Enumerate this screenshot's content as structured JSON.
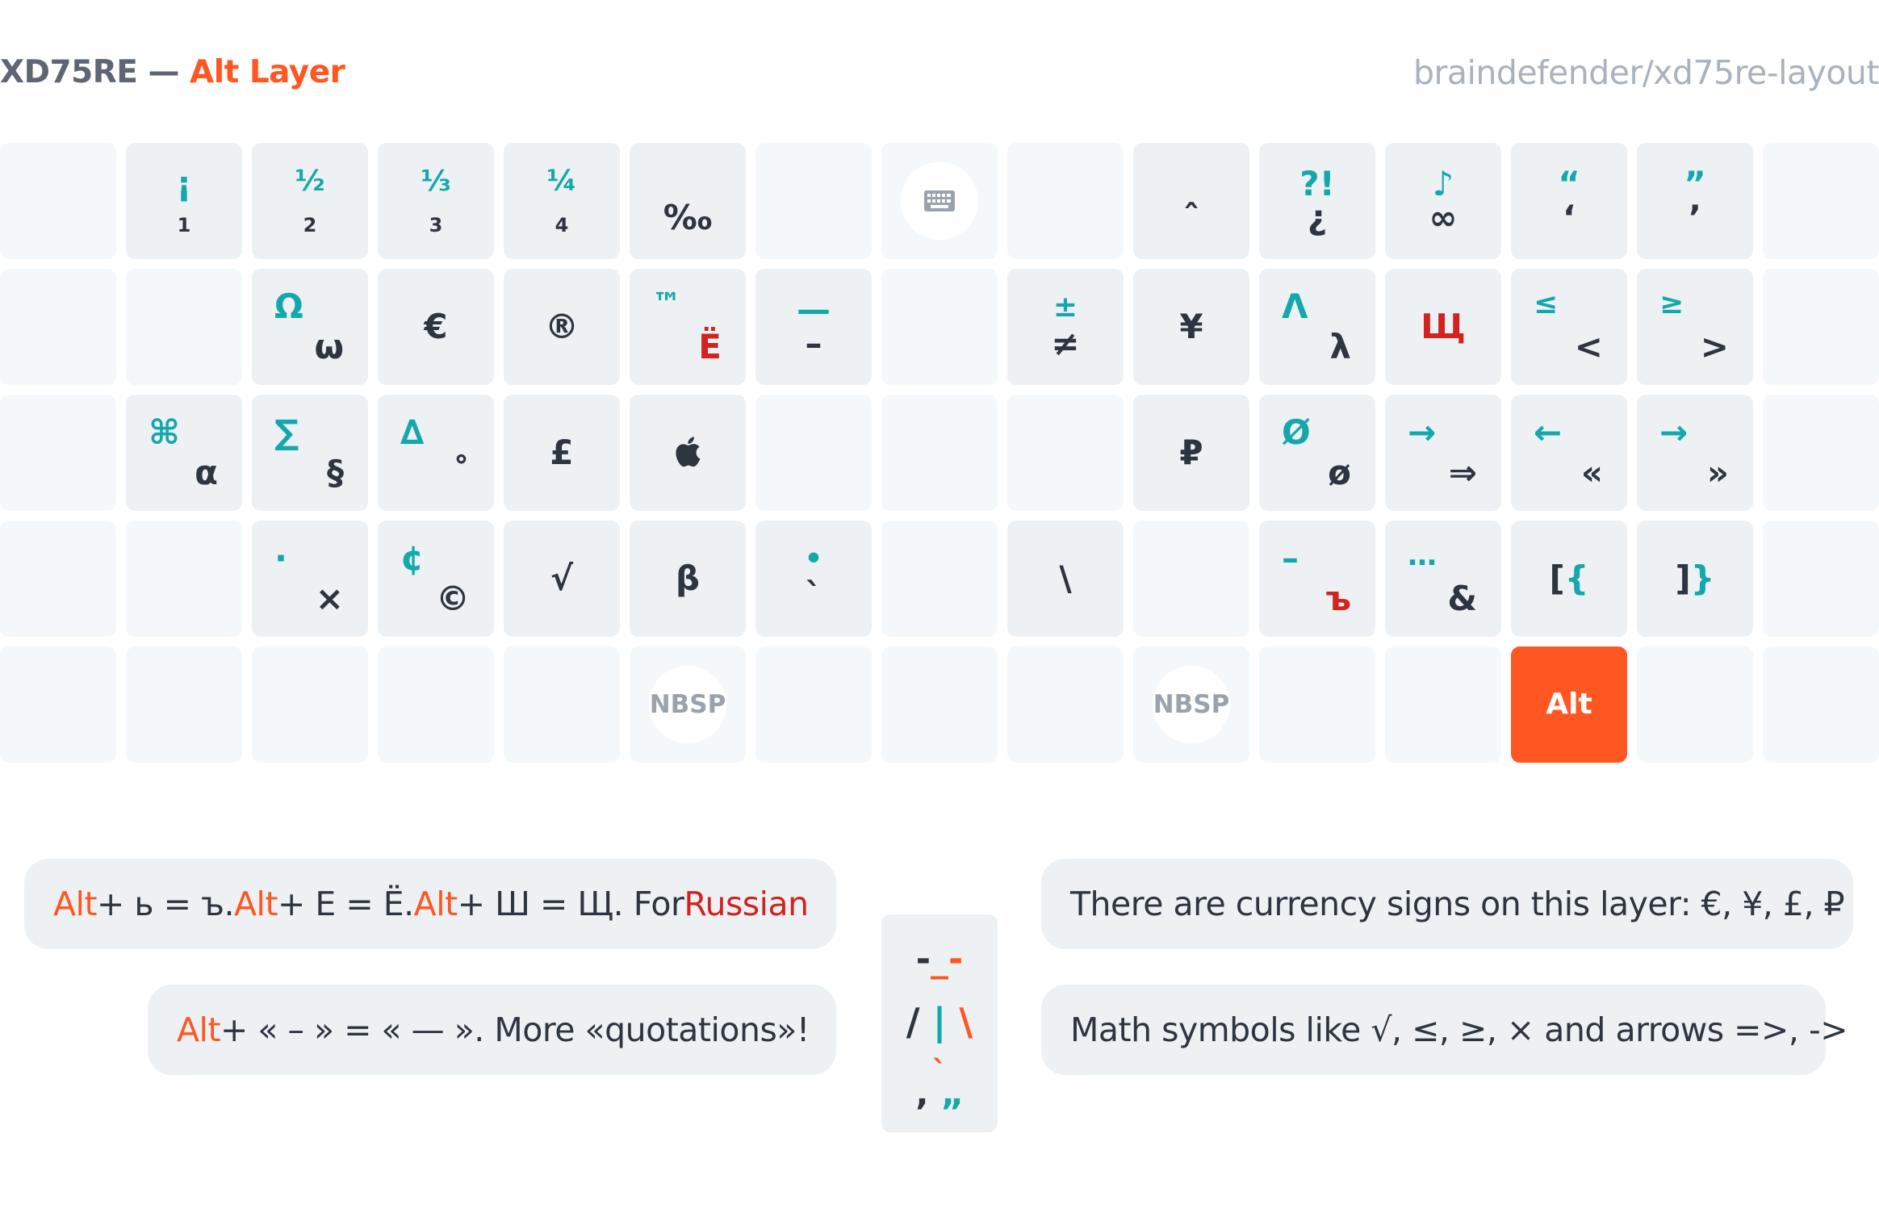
{
  "header": {
    "title_main": "XD75RE — ",
    "title_accent": "Alt Layer",
    "repo": "braindefender/xd75re-layout"
  },
  "colors": {
    "accent": "#ff5722",
    "teal": "#14a8ad",
    "red": "#d2231f",
    "dark": "#2d3540",
    "key_bg": "#edf1f4",
    "key_bg_empty": "#f5f8fa"
  },
  "keyboard": {
    "rows": [
      [
        {
          "bg": "light",
          "legends": []
        },
        {
          "bg": "mid",
          "legends": [
            {
              "text": "¡",
              "color": "t",
              "size": "l",
              "pos": "tc"
            },
            {
              "text": "1",
              "color": "d",
              "size": "s",
              "pos": "bc"
            }
          ]
        },
        {
          "bg": "mid",
          "legends": [
            {
              "text": "½",
              "color": "t",
              "size": "m",
              "pos": "tc"
            },
            {
              "text": "2",
              "color": "d",
              "size": "s",
              "pos": "bc"
            }
          ]
        },
        {
          "bg": "mid",
          "legends": [
            {
              "text": "⅓",
              "color": "t",
              "size": "m",
              "pos": "tc"
            },
            {
              "text": "3",
              "color": "d",
              "size": "s",
              "pos": "bc"
            }
          ]
        },
        {
          "bg": "mid",
          "legends": [
            {
              "text": "¼",
              "color": "t",
              "size": "m",
              "pos": "tc"
            },
            {
              "text": "4",
              "color": "d",
              "size": "s",
              "pos": "bc"
            }
          ]
        },
        {
          "bg": "mid",
          "legends": [
            {
              "text": "‰",
              "color": "d",
              "size": "l",
              "pos": "bc"
            }
          ]
        },
        {
          "bg": "light",
          "legends": []
        },
        {
          "bg": "light",
          "icon": "keyboard-icon",
          "legends": []
        },
        {
          "bg": "light",
          "legends": []
        },
        {
          "bg": "mid",
          "legends": [
            {
              "text": "ˆ",
              "color": "d",
              "size": "l",
              "pos": "bc"
            }
          ]
        },
        {
          "bg": "mid",
          "legends": [
            {
              "text": "?!",
              "color": "t",
              "size": "l",
              "pos": "tc"
            },
            {
              "text": "¿",
              "color": "d",
              "size": "l",
              "pos": "bc"
            }
          ]
        },
        {
          "bg": "mid",
          "legends": [
            {
              "text": "♪",
              "color": "t",
              "size": "l",
              "pos": "tc"
            },
            {
              "text": "∞",
              "color": "d",
              "size": "l",
              "pos": "bc"
            }
          ]
        },
        {
          "bg": "mid",
          "legends": [
            {
              "text": "“",
              "color": "t",
              "size": "l",
              "pos": "tc"
            },
            {
              "text": "‘",
              "color": "d",
              "size": "l",
              "pos": "bc"
            }
          ]
        },
        {
          "bg": "mid",
          "legends": [
            {
              "text": "”",
              "color": "t",
              "size": "l",
              "pos": "tc"
            },
            {
              "text": "’",
              "color": "d",
              "size": "l",
              "pos": "bc"
            }
          ]
        },
        {
          "bg": "light",
          "legends": []
        }
      ],
      [
        {
          "bg": "light",
          "legends": []
        },
        {
          "bg": "light",
          "legends": []
        },
        {
          "bg": "mid",
          "legends": [
            {
              "text": "Ω",
              "color": "t",
              "size": "l",
              "pos": "tl"
            },
            {
              "text": "ω",
              "color": "d",
              "size": "l",
              "pos": "br"
            }
          ]
        },
        {
          "bg": "mid",
          "legends": [
            {
              "text": "€",
              "color": "d",
              "size": "l",
              "pos": "c"
            }
          ]
        },
        {
          "bg": "mid",
          "legends": [
            {
              "text": "®",
              "color": "d",
              "size": "l",
              "pos": "c"
            }
          ]
        },
        {
          "bg": "mid",
          "legends": [
            {
              "text": "™",
              "color": "t",
              "size": "m",
              "pos": "tl"
            },
            {
              "text": "Ё",
              "color": "r",
              "size": "l",
              "pos": "br"
            }
          ]
        },
        {
          "bg": "mid",
          "legends": [
            {
              "text": "—",
              "color": "t",
              "size": "l",
              "pos": "tc"
            },
            {
              "text": "–",
              "color": "d",
              "size": "l",
              "pos": "bc"
            }
          ]
        },
        {
          "bg": "light",
          "legends": []
        },
        {
          "bg": "mid",
          "legends": [
            {
              "text": "±",
              "color": "t",
              "size": "m",
              "pos": "tc"
            },
            {
              "text": "≠",
              "color": "d",
              "size": "l",
              "pos": "bc"
            }
          ]
        },
        {
          "bg": "mid",
          "legends": [
            {
              "text": "¥",
              "color": "d",
              "size": "l",
              "pos": "c"
            }
          ]
        },
        {
          "bg": "mid",
          "legends": [
            {
              "text": "Λ",
              "color": "t",
              "size": "l",
              "pos": "tl"
            },
            {
              "text": "λ",
              "color": "d",
              "size": "l",
              "pos": "br"
            }
          ]
        },
        {
          "bg": "mid",
          "legends": [
            {
              "text": "Щ",
              "color": "r",
              "size": "l",
              "pos": "c"
            }
          ]
        },
        {
          "bg": "mid",
          "legends": [
            {
              "text": "≤",
              "color": "t",
              "size": "m",
              "pos": "tl"
            },
            {
              "text": "<",
              "color": "d",
              "size": "l",
              "pos": "br"
            }
          ]
        },
        {
          "bg": "mid",
          "legends": [
            {
              "text": "≥",
              "color": "t",
              "size": "m",
              "pos": "tl"
            },
            {
              "text": ">",
              "color": "d",
              "size": "l",
              "pos": "br"
            }
          ]
        },
        {
          "bg": "light",
          "legends": []
        }
      ],
      [
        {
          "bg": "light",
          "legends": []
        },
        {
          "bg": "mid",
          "legends": [
            {
              "text": "⌘",
              "color": "t",
              "size": "l",
              "pos": "tl"
            },
            {
              "text": "α",
              "color": "d",
              "size": "l",
              "pos": "br"
            }
          ]
        },
        {
          "bg": "mid",
          "legends": [
            {
              "text": "∑",
              "color": "t",
              "size": "l",
              "pos": "tl"
            },
            {
              "text": "§",
              "color": "d",
              "size": "l",
              "pos": "br"
            }
          ]
        },
        {
          "bg": "mid",
          "legends": [
            {
              "text": "∆",
              "color": "t",
              "size": "l",
              "pos": "tl"
            },
            {
              "text": "˚",
              "color": "d",
              "size": "l",
              "pos": "br"
            }
          ]
        },
        {
          "bg": "mid",
          "legends": [
            {
              "text": "£",
              "color": "d",
              "size": "l",
              "pos": "c"
            }
          ]
        },
        {
          "bg": "mid",
          "icon": "apple-logo-icon",
          "legends": []
        },
        {
          "bg": "light",
          "legends": []
        },
        {
          "bg": "light",
          "legends": []
        },
        {
          "bg": "light",
          "legends": []
        },
        {
          "bg": "mid",
          "legends": [
            {
              "text": "₽",
              "color": "d",
              "size": "l",
              "pos": "c"
            }
          ]
        },
        {
          "bg": "mid",
          "legends": [
            {
              "text": "Ø",
              "color": "t",
              "size": "l",
              "pos": "tl"
            },
            {
              "text": "ø",
              "color": "d",
              "size": "l",
              "pos": "br"
            }
          ]
        },
        {
          "bg": "mid",
          "legends": [
            {
              "text": "→",
              "color": "t",
              "size": "l",
              "pos": "tl"
            },
            {
              "text": "⇒",
              "color": "d",
              "size": "l",
              "pos": "br"
            }
          ]
        },
        {
          "bg": "mid",
          "legends": [
            {
              "text": "←",
              "color": "t",
              "size": "l",
              "pos": "tl"
            },
            {
              "text": "«",
              "color": "d",
              "size": "l",
              "pos": "br"
            }
          ]
        },
        {
          "bg": "mid",
          "legends": [
            {
              "text": "→",
              "color": "t",
              "size": "l",
              "pos": "tl"
            },
            {
              "text": "»",
              "color": "d",
              "size": "l",
              "pos": "br"
            }
          ]
        },
        {
          "bg": "light",
          "legends": []
        }
      ],
      [
        {
          "bg": "light",
          "legends": []
        },
        {
          "bg": "light",
          "legends": []
        },
        {
          "bg": "mid",
          "legends": [
            {
              "text": "·",
              "color": "t",
              "size": "l",
              "pos": "tl"
            },
            {
              "text": "×",
              "color": "d",
              "size": "l",
              "pos": "br"
            }
          ]
        },
        {
          "bg": "mid",
          "legends": [
            {
              "text": "¢",
              "color": "t",
              "size": "l",
              "pos": "tl"
            },
            {
              "text": "©",
              "color": "d",
              "size": "l",
              "pos": "br"
            }
          ]
        },
        {
          "bg": "mid",
          "legends": [
            {
              "text": "√",
              "color": "d",
              "size": "l",
              "pos": "c"
            }
          ]
        },
        {
          "bg": "mid",
          "legends": [
            {
              "text": "β",
              "color": "d",
              "size": "l",
              "pos": "c"
            }
          ]
        },
        {
          "bg": "mid",
          "legends": [
            {
              "text": "•",
              "color": "t",
              "size": "m",
              "pos": "tc"
            },
            {
              "text": "`",
              "color": "d",
              "size": "l",
              "pos": "bc"
            }
          ]
        },
        {
          "bg": "light",
          "legends": []
        },
        {
          "bg": "mid",
          "legends": [
            {
              "text": "\\",
              "color": "d",
              "size": "l",
              "pos": "c"
            }
          ]
        },
        {
          "bg": "light",
          "legends": []
        },
        {
          "bg": "mid",
          "legends": [
            {
              "text": "–",
              "color": "t",
              "size": "l",
              "pos": "tl"
            },
            {
              "text": "ъ",
              "color": "r",
              "size": "l",
              "pos": "br"
            }
          ]
        },
        {
          "bg": "mid",
          "legends": [
            {
              "text": "…",
              "color": "t",
              "size": "m",
              "pos": "tl"
            },
            {
              "text": "&",
              "color": "d",
              "size": "l",
              "pos": "br"
            }
          ]
        },
        {
          "bg": "mid",
          "legends": [
            {
              "text": "[",
              "color": "d",
              "size": "l",
              "pos": "c",
              "pair": "{"
            }
          ]
        },
        {
          "bg": "mid",
          "legends": [
            {
              "text": "]",
              "color": "d",
              "size": "l",
              "pos": "c",
              "pair": "}"
            }
          ]
        },
        {
          "bg": "light",
          "legends": []
        }
      ],
      [
        {
          "bg": "light",
          "legends": []
        },
        {
          "bg": "light",
          "legends": []
        },
        {
          "bg": "light",
          "legends": []
        },
        {
          "bg": "light",
          "legends": []
        },
        {
          "bg": "light",
          "legends": []
        },
        {
          "bg": "light",
          "badge": "NBSP",
          "legends": []
        },
        {
          "bg": "light",
          "legends": []
        },
        {
          "bg": "light",
          "legends": []
        },
        {
          "bg": "light",
          "legends": []
        },
        {
          "bg": "light",
          "badge": "NBSP",
          "legends": []
        },
        {
          "bg": "light",
          "legends": []
        },
        {
          "bg": "light",
          "legends": []
        },
        {
          "bg": "accent",
          "legends": [
            {
              "text": "Alt",
              "color": "w",
              "size": "m",
              "pos": "c"
            }
          ]
        },
        {
          "bg": "light",
          "legends": []
        },
        {
          "bg": "light",
          "legends": []
        }
      ]
    ]
  },
  "notes": {
    "russian": {
      "alt": "Alt",
      "p1": " + ь = ъ. ",
      "p2": " + Е = Ё. ",
      "p3": " + Ш = Щ. For ",
      "russian": "Russian"
    },
    "quotes": {
      "alt": "Alt",
      "text": " + « – » = « — ». More «quotations»!"
    },
    "currency": "There are currency signs on this layer: €, ¥, £, ₽",
    "math": "Math symbols like √, ≤, ≥, × and arrows =>, ->"
  },
  "art": {
    "line1_dash": "-",
    "line1_mid": "_",
    "line1_end": "-",
    "line2_l": "/",
    "line2_m": "|",
    "line2_r": "\\",
    "line3": "`",
    "line4_a": "‚",
    "line4_b": "„"
  }
}
